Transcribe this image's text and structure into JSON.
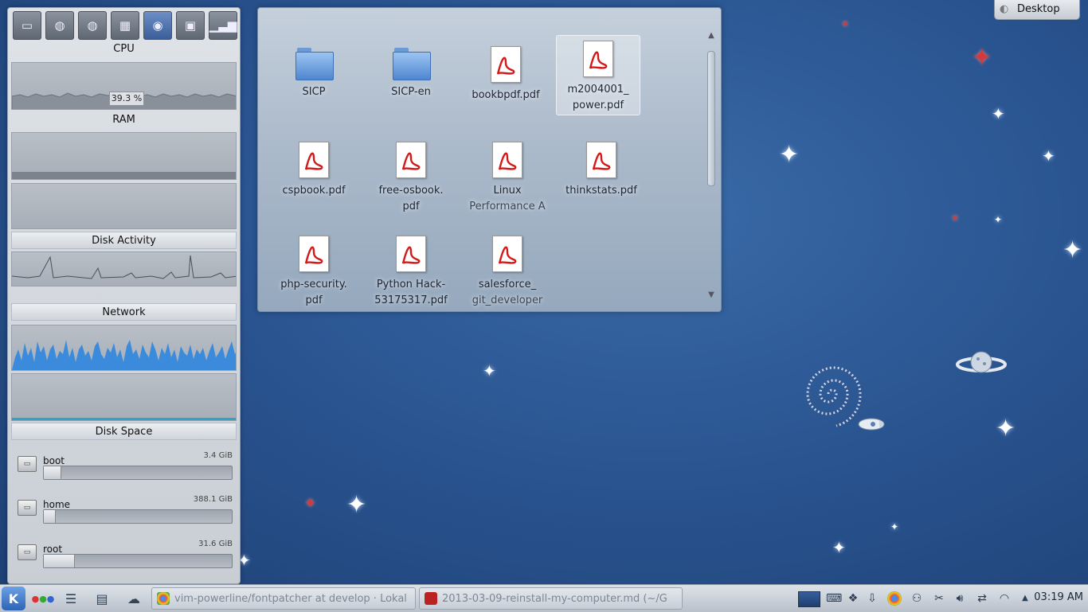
{
  "desktop_toolbox": {
    "label": "Desktop"
  },
  "sysmon": {
    "cpu": {
      "label": "CPU",
      "value": "39.3 %"
    },
    "ram": {
      "label": "RAM"
    },
    "disk_activity": {
      "label": "Disk Activity"
    },
    "network": {
      "label": "Network"
    },
    "disk_space": {
      "label": "Disk Space",
      "disks": [
        {
          "name": "boot",
          "size": "3.4 GiB",
          "used_fraction": 0.09
        },
        {
          "name": "home",
          "size": "388.1 GiB",
          "used_fraction": 0.06
        },
        {
          "name": "root",
          "size": "31.6 GiB",
          "used_fraction": 0.16
        }
      ]
    }
  },
  "folderview": {
    "items": [
      {
        "name": "SICP",
        "type": "folder"
      },
      {
        "name": "SICP-en",
        "type": "folder"
      },
      {
        "name": "bookbpdf.pdf",
        "type": "pdf"
      },
      {
        "name_line1": "m2004001_",
        "name_line2": "power.pdf",
        "type": "pdf"
      },
      {
        "name": "cspbook.pdf",
        "type": "pdf"
      },
      {
        "name_line1": "free-osbook.",
        "name_line2": "pdf",
        "type": "pdf"
      },
      {
        "name_line1": "Linux",
        "name_line2": "Performance A",
        "type": "pdf"
      },
      {
        "name": "thinkstats.pdf",
        "type": "pdf"
      },
      {
        "name_line1": "php-security.",
        "name_line2": "pdf",
        "type": "pdf"
      },
      {
        "name_line1": "Python Hack-",
        "name_line2": "53175317.pdf",
        "type": "pdf"
      },
      {
        "name_line1": "salesforce_",
        "name_line2": "git_developer",
        "type": "pdf"
      }
    ]
  },
  "taskbar": {
    "tasks": [
      {
        "label": "vim-powerline/fontpatcher at develop · Lokal",
        "icon": "chrome-icon"
      },
      {
        "label": "2013-03-09-reinstall-my-computer.md (~/G",
        "icon": "terminal-icon"
      }
    ],
    "clock": "03:19 AM"
  }
}
